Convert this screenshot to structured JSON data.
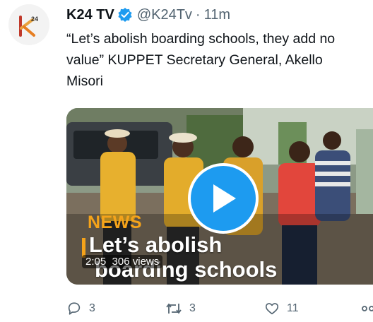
{
  "tweet": {
    "display_name": "K24 TV",
    "handle": "@K24Tv",
    "separator": "·",
    "time": "11m",
    "text": "“Let’s abolish boarding schools, they add no value” KUPPET Secretary General, Akello Misori"
  },
  "avatar": {
    "logo_text": "k",
    "logo_number": "24",
    "brand_color": "#e8a33d"
  },
  "media": {
    "overlay_label": "NEWS",
    "headline_line1": "Let’s abolish",
    "headline_line2": "boarding schools",
    "duration": "2:05",
    "views": "306 views",
    "play_color": "#1d9bf0"
  },
  "actions": {
    "replies": "3",
    "retweets": "3",
    "likes": "11"
  },
  "icons": [
    "verified-badge-icon",
    "play-icon",
    "reply-icon",
    "retweet-icon",
    "like-icon",
    "share-icon"
  ]
}
